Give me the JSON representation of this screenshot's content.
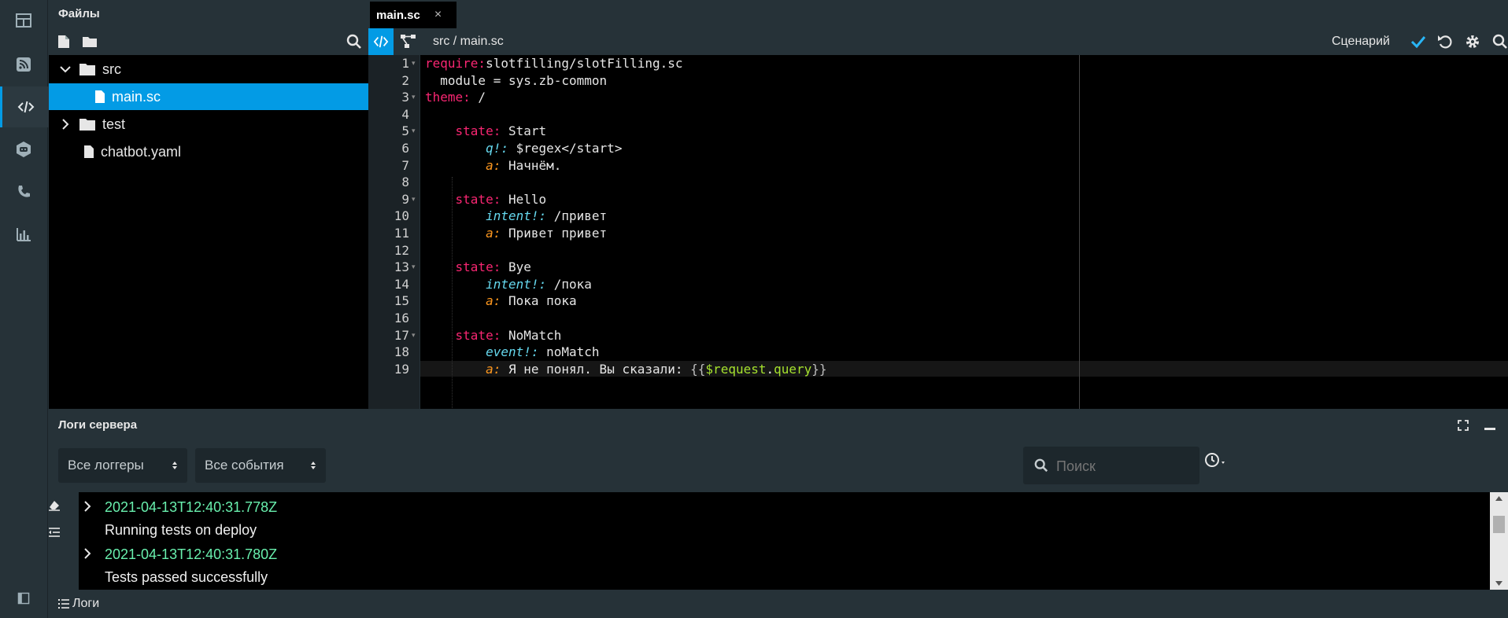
{
  "rail": {
    "items": [
      "dashboard-icon",
      "rss-icon",
      "code-icon",
      "bot-icon",
      "phone-icon",
      "analytics-icon"
    ]
  },
  "files": {
    "title": "Файлы",
    "tree": [
      {
        "label": "src",
        "type": "folder",
        "expanded": true
      },
      {
        "label": "main.sc",
        "type": "file",
        "selected": true
      },
      {
        "label": "test",
        "type": "folder",
        "expanded": false
      },
      {
        "label": "chatbot.yaml",
        "type": "file"
      }
    ]
  },
  "editor": {
    "tab_label": "main.sc",
    "tab_close": "×",
    "breadcrumb": "src / main.sc",
    "scenario_label": "Сценарий",
    "line_numbers": [
      "1",
      "2",
      "3",
      "4",
      "5",
      "6",
      "7",
      "8",
      "9",
      "10",
      "11",
      "12",
      "13",
      "14",
      "15",
      "16",
      "17",
      "18",
      "19"
    ],
    "code": [
      {
        "t": [
          [
            "kw",
            "require:"
          ],
          [
            "",
            "slotfilling/slotFilling.sc"
          ]
        ]
      },
      {
        "t": [
          [
            "",
            "  module = sys.zb-common"
          ]
        ]
      },
      {
        "t": [
          [
            "kw",
            "theme:"
          ],
          [
            "",
            " /"
          ]
        ]
      },
      {
        "t": []
      },
      {
        "t": [
          [
            "",
            "    "
          ],
          [
            "kw",
            "state:"
          ],
          [
            "",
            " Start"
          ]
        ]
      },
      {
        "t": [
          [
            "",
            "        "
          ],
          [
            "it",
            "q!:"
          ],
          [
            "",
            " $regex</start>"
          ]
        ]
      },
      {
        "t": [
          [
            "",
            "        "
          ],
          [
            "ans",
            "a:"
          ],
          [
            "",
            " Начнём."
          ]
        ]
      },
      {
        "t": []
      },
      {
        "t": [
          [
            "",
            "    "
          ],
          [
            "kw",
            "state:"
          ],
          [
            "",
            " Hello"
          ]
        ]
      },
      {
        "t": [
          [
            "",
            "        "
          ],
          [
            "it",
            "intent!:"
          ],
          [
            "",
            " /привет"
          ]
        ]
      },
      {
        "t": [
          [
            "",
            "        "
          ],
          [
            "ans",
            "a:"
          ],
          [
            "",
            " Привет привет"
          ]
        ]
      },
      {
        "t": []
      },
      {
        "t": [
          [
            "",
            "    "
          ],
          [
            "kw",
            "state:"
          ],
          [
            "",
            " Bye"
          ]
        ]
      },
      {
        "t": [
          [
            "",
            "        "
          ],
          [
            "it",
            "intent!:"
          ],
          [
            "",
            " /пока"
          ]
        ]
      },
      {
        "t": [
          [
            "",
            "        "
          ],
          [
            "ans",
            "a:"
          ],
          [
            "",
            " Пока пока"
          ]
        ]
      },
      {
        "t": []
      },
      {
        "t": [
          [
            "",
            "    "
          ],
          [
            "kw",
            "state:"
          ],
          [
            "",
            " NoMatch"
          ]
        ]
      },
      {
        "t": [
          [
            "",
            "        "
          ],
          [
            "it",
            "event!:"
          ],
          [
            "",
            " noMatch"
          ]
        ]
      },
      {
        "t": [
          [
            "",
            "        "
          ],
          [
            "ans",
            "a:"
          ],
          [
            "",
            " Я не понял. Вы сказали: "
          ],
          [
            "brace",
            "{{"
          ],
          [
            "var",
            "$request"
          ],
          [
            "",
            "."
          ],
          [
            "var",
            "query"
          ],
          [
            "brace",
            "}}"
          ]
        ]
      }
    ]
  },
  "logs": {
    "title": "Логи сервера",
    "logger_select": "Все логгеры",
    "event_select": "Все события",
    "search_placeholder": "Поиск",
    "entries": [
      {
        "timestamp": "2021-04-13T12:40:31.778Z",
        "message": "Running tests on deploy"
      },
      {
        "timestamp": "2021-04-13T12:40:31.780Z",
        "message": "Tests passed successfully"
      }
    ],
    "footer_label": "Логи"
  }
}
